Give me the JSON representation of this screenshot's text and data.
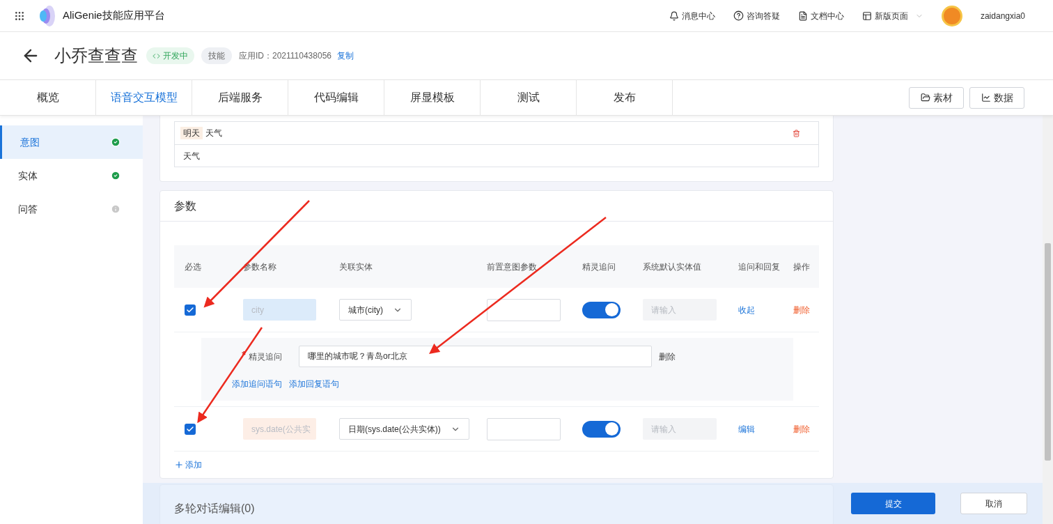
{
  "app": {
    "name": "AliGenie技能应用平台"
  },
  "header_links": [
    {
      "kind": "bell",
      "label": "消息中心",
      "dropdown": false
    },
    {
      "kind": "help",
      "label": "咨询答疑",
      "dropdown": false
    },
    {
      "kind": "doc",
      "label": "文档中心",
      "dropdown": false
    },
    {
      "kind": "layout",
      "label": "新版页面",
      "dropdown": true
    }
  ],
  "user": {
    "name": "zaidangxia0"
  },
  "skill": {
    "name": "小乔查查查",
    "status": "开发中",
    "type": "技能",
    "id_label": "应用ID：",
    "id": "2021110438056",
    "copy": "复制"
  },
  "tabs": [
    {
      "label": "概览",
      "selected": false
    },
    {
      "label": "语音交互模型",
      "selected": true
    },
    {
      "label": "后端服务",
      "selected": false
    },
    {
      "label": "代码编辑",
      "selected": false
    },
    {
      "label": "屏显模板",
      "selected": false
    },
    {
      "label": "测试",
      "selected": false
    },
    {
      "label": "发布",
      "selected": false
    }
  ],
  "toolbar_buttons": [
    {
      "kind": "folder",
      "label": "素材"
    },
    {
      "kind": "chart",
      "label": "数据"
    }
  ],
  "sidebar": [
    {
      "label": "意图",
      "selected": true,
      "complete": true
    },
    {
      "label": "实体",
      "selected": false,
      "complete": true
    },
    {
      "label": "问答",
      "selected": false,
      "complete": false
    }
  ],
  "utterances": [
    {
      "slot": "明天",
      "text": "天气",
      "deletable": true
    },
    {
      "text": "天气",
      "deletable": false
    }
  ],
  "params": {
    "title": "参数",
    "columns": [
      "必选",
      "参数名称",
      "关联实体",
      "前置意图参数",
      "精灵追问",
      "系统默认实体值",
      "追问和回复",
      "操作"
    ],
    "rows": [
      {
        "required": true,
        "name": "city",
        "color": "#dcebfa",
        "entity": "城市(city)",
        "ask": true,
        "default_placeholder": "请输入",
        "toggle_action": "收起",
        "delete": "删除",
        "expanded": true,
        "detail": {
          "label": "精灵追问",
          "required_mark": "*",
          "value": "哪里的城市呢？青岛or北京",
          "delete": "删除",
          "links": [
            "添加追问语句",
            "添加回复语句"
          ]
        }
      },
      {
        "required": true,
        "name": "sys.date(公共实",
        "color": "#fdeee6",
        "entity": "日期(sys.date(公共实体))",
        "ask": true,
        "default_placeholder": "请输入",
        "toggle_action": "编辑",
        "delete": "删除",
        "expanded": false
      }
    ],
    "add": "添加"
  },
  "multi_turn": {
    "title": "多轮对话编辑(0)"
  },
  "footer_buttons": [
    {
      "label": "提交",
      "primary": true
    },
    {
      "label": "取消",
      "primary": false
    }
  ]
}
